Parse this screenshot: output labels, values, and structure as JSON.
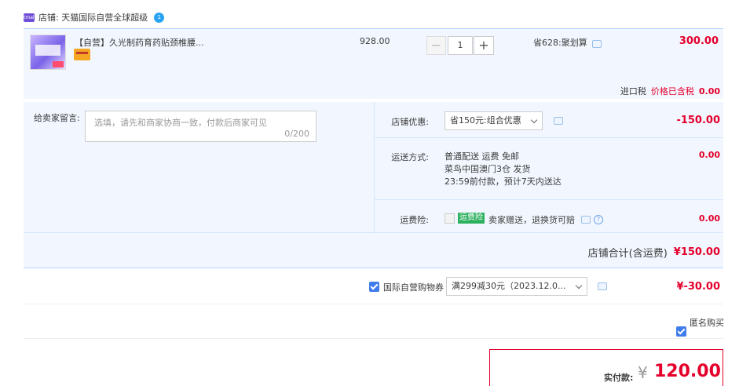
{
  "store": {
    "badge": "tmall",
    "label": "店铺: 天猫国际自营全球超级",
    "wangwang_text": "1"
  },
  "item": {
    "title": "【自营】久光制药育药贴颈椎腰...",
    "unit_price": "928.00",
    "quantity": "1",
    "promotion": "省628:聚划算",
    "amount": "300.00",
    "tax_label": "进口税",
    "tax_note": "价格已含税",
    "tax_amount": "0.00"
  },
  "message": {
    "label": "给卖家留言:",
    "placeholder": "选填，请先和商家协商一致，付款后商家可见",
    "count": "0/200"
  },
  "store_coupon": {
    "label": "店铺优惠:",
    "selected": "省150元:组合优惠",
    "amount": "-150.00"
  },
  "shipping": {
    "label": "运送方式:",
    "line1": "普通配送 运费 免邮",
    "line2": "菜鸟中国澳门3仓  发货",
    "line3": "23:59前付款，预计7天内送达",
    "amount": "0.00"
  },
  "insurance": {
    "label": "运费险:",
    "badge": "运费险",
    "text": "卖家赠送，退换货可赔",
    "amount": "0.00"
  },
  "store_total": {
    "label": "店铺合计(含运费)",
    "amount": "¥150.00"
  },
  "platform_coupon": {
    "label": "国际自营购物券",
    "selected": "满299减30元（2023.12.0...",
    "amount": "¥-30.00"
  },
  "anonymous": {
    "label": "匿名购买"
  },
  "payment": {
    "label": "实付款:",
    "currency": "¥",
    "amount": "120.00"
  },
  "colors": {
    "accent_red": "#e4002b",
    "panel_blue": "#f2f7ff",
    "checkbox_blue": "#3f7cec",
    "insurance_green": "#2db15f"
  }
}
